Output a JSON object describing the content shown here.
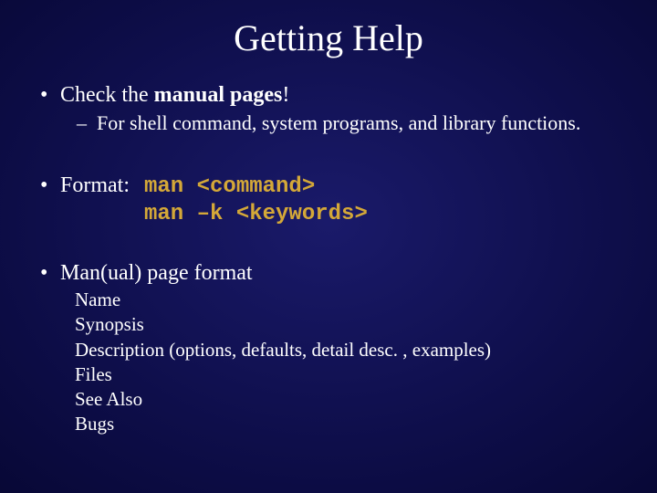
{
  "title": "Getting Help",
  "bullet1": {
    "prefix": "Check the ",
    "bold": "manual pages",
    "suffix": "!",
    "sub": "For shell command, system programs, and library functions."
  },
  "bullet2": {
    "label": "Format:",
    "cmd1": "man <command>",
    "cmd2": "man –k <keywords>"
  },
  "bullet3": {
    "label": "Man(ual) page format",
    "items": [
      "Name",
      "Synopsis",
      "Description (options, defaults, detail desc. , examples)",
      "Files",
      "See Also",
      "Bugs"
    ]
  }
}
